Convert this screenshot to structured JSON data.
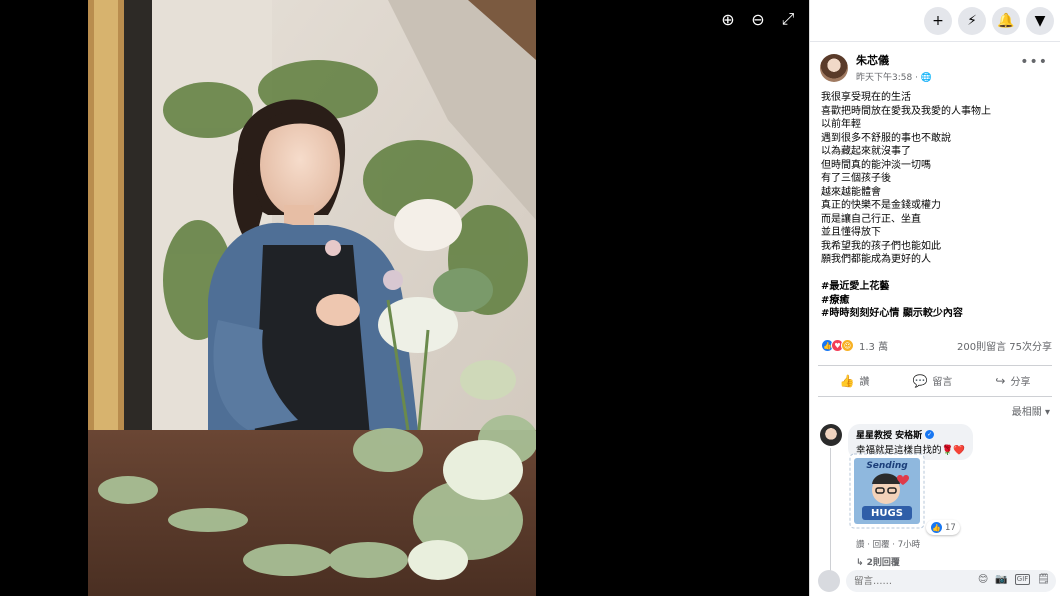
{
  "viewer": {
    "tools": [
      {
        "name": "zoom-in-icon",
        "glyph": "⊕"
      },
      {
        "name": "zoom-out-icon",
        "glyph": "⊖"
      },
      {
        "name": "fullscreen-icon",
        "glyph": "⤢"
      }
    ]
  },
  "topbar": {
    "buttons": [
      {
        "name": "create-icon",
        "glyph": "+"
      },
      {
        "name": "messenger-icon",
        "glyph": "⚡"
      },
      {
        "name": "notifications-icon",
        "glyph": "🔔"
      },
      {
        "name": "account-menu-icon",
        "glyph": "▼"
      }
    ]
  },
  "post": {
    "author": "朱芯儀",
    "time": "昨天下午3:58 · ",
    "privacy_glyph": "🌐",
    "more_glyph": "•••",
    "lines": [
      "我很享受現在的生活",
      "喜歡把時間放在愛我及我愛的人事物上",
      "以前年輕",
      "遇到很多不舒服的事也不敢說",
      "以為藏起來就沒事了",
      "但時間真的能沖淡一切嗎",
      "有了三個孩子後",
      "越來越能體會",
      "真正的快樂不是金錢或權力",
      "而是讓自己行正、坐直",
      "並且懂得放下",
      "我希望我的孩子們也能如此",
      "願我們都能成為更好的人"
    ],
    "hashtags": [
      "#最近愛上花藝",
      "#療癒",
      "#時時刻刻好心情 顯示較少內容"
    ],
    "reactions_count": "1.3 萬",
    "comments_shares": "200則留言  75次分享",
    "actions": [
      {
        "name": "like-button",
        "icon": "like-icon",
        "glyph": "👍",
        "label": "讚"
      },
      {
        "name": "comment-button",
        "icon": "comment-icon",
        "glyph": "💬",
        "label": "留言"
      },
      {
        "name": "share-button",
        "icon": "share-icon",
        "glyph": "↪",
        "label": "分享"
      }
    ],
    "sort_label": "最相關 ▾"
  },
  "comment": {
    "name": "星星教授 安格斯",
    "text": "幸福就是這樣自找的🌹❤️",
    "sticker_top": "Sending",
    "sticker_bottom": "HUGS",
    "reaction_count": "17",
    "meta": "讚 · 回覆 · 7小時",
    "replies": "↳ 2則回覆"
  },
  "composer": {
    "placeholder": "留言……",
    "icons": [
      "😊",
      "📷",
      "GIF",
      "🗒"
    ]
  }
}
